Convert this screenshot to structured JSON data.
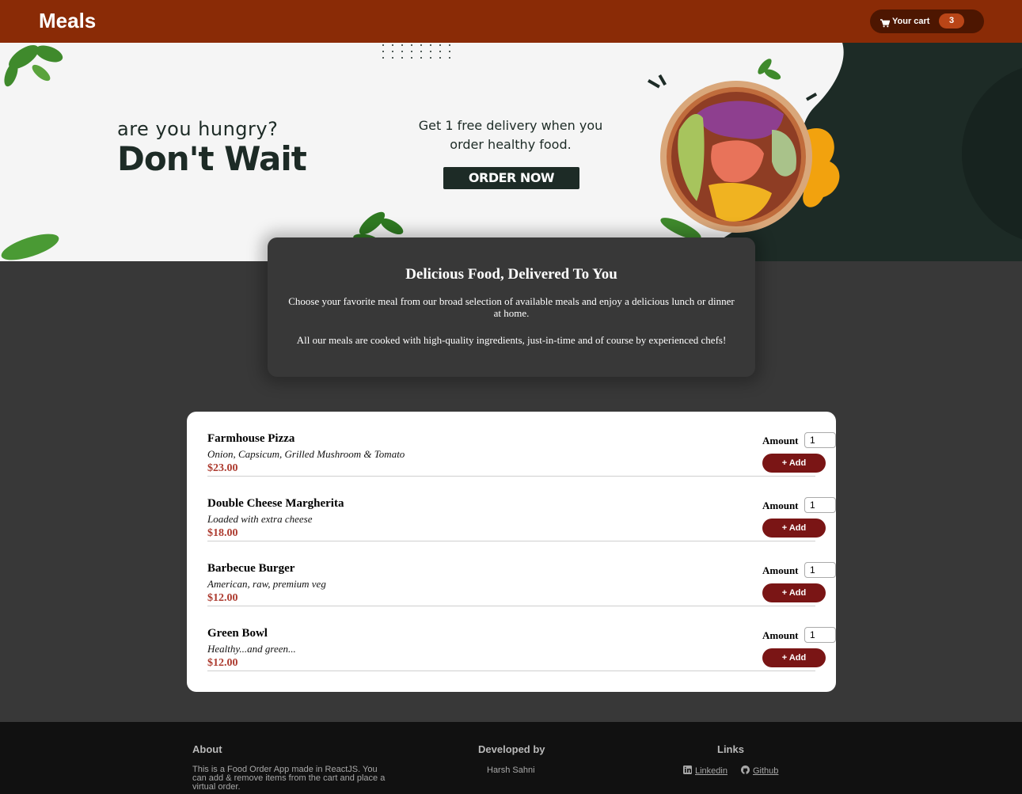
{
  "header": {
    "logo": "Meals",
    "cart_label": "Your cart",
    "cart_count": "3",
    "cart_icon": "shopping-cart-icon"
  },
  "banner": {
    "tagline": "are you hungry?",
    "headline": "Don't Wait",
    "promo_line1": "Get 1 free delivery when you",
    "promo_line2": "order healthy food.",
    "order_button": "ORDER NOW"
  },
  "summary": {
    "title": "Delicious Food, Delivered To You",
    "paragraph1": "Choose your favorite meal from our broad selection of available meals and enjoy a delicious lunch or dinner at home.",
    "paragraph2": "All our meals are cooked with high-quality ingredients, just-in-time and of course by experienced chefs!"
  },
  "meals": {
    "amount_label": "Amount",
    "add_label": "+ Add",
    "items": [
      {
        "name": "Farmhouse Pizza",
        "description": "Onion, Capsicum, Grilled Mushroom & Tomato",
        "price": "$23.00",
        "amount": "1"
      },
      {
        "name": "Double Cheese Margherita",
        "description": "Loaded with extra cheese",
        "price": "$18.00",
        "amount": "1"
      },
      {
        "name": "Barbecue Burger",
        "description": "American, raw, premium veg",
        "price": "$12.00",
        "amount": "1"
      },
      {
        "name": "Green Bowl",
        "description": "Healthy...and green...",
        "price": "$12.00",
        "amount": "1"
      }
    ]
  },
  "footer": {
    "about_heading": "About",
    "about_text": "This is a Food Order App made in ReactJS. You can add & remove items from the cart and place a virtual order.",
    "developed_heading": "Developed by",
    "developer": "Harsh Sahni",
    "links_heading": "Links",
    "linkedin": "Linkedin",
    "github": "Github"
  },
  "colors": {
    "header_bg": "#8a2b06",
    "cart_bg": "#4d1601",
    "badge_bg": "#b94517",
    "page_bg": "#383838",
    "add_button": "#7a1515",
    "price": "#ad3b2f",
    "banner_dark": "#1d2b26"
  }
}
